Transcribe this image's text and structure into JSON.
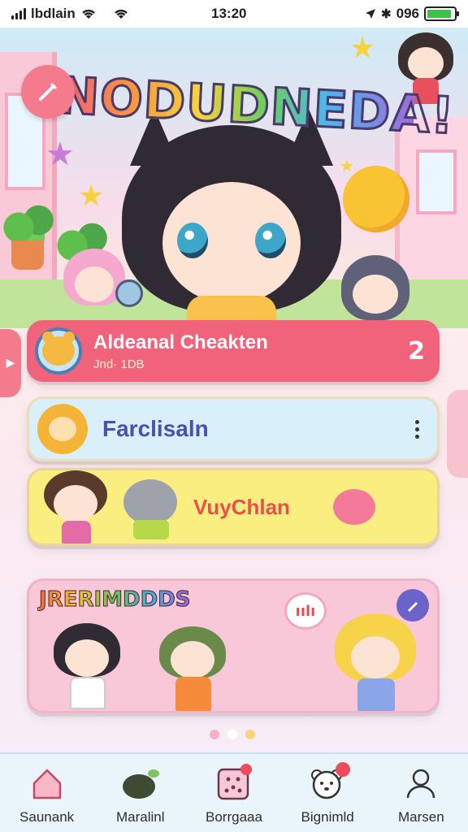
{
  "status_bar": {
    "carrier": "lbdlain",
    "time": "13:20",
    "battery_text": "096",
    "battery_level": 0.9
  },
  "hero": {
    "title": "NODUDNEDA!"
  },
  "cards": [
    {
      "title": "Aldeanal Cheakten",
      "subtitle": "Jnd· 1DB",
      "badge": "2"
    },
    {
      "title": "Farclisaln"
    },
    {
      "title": "VuyChlan"
    },
    {
      "title": "JRERIMDDDS",
      "bubble": "ıılı"
    }
  ],
  "bottom_nav": [
    {
      "label": "Saunank",
      "icon": "home-icon"
    },
    {
      "label": "Maralinl",
      "icon": "leaf-creature-icon"
    },
    {
      "label": "Borrgaaa",
      "icon": "grid-box-icon"
    },
    {
      "label": "Bignimld",
      "icon": "bear-face-icon"
    },
    {
      "label": "Marsen",
      "icon": "person-icon"
    }
  ],
  "colors": {
    "accent_pink": "#f1637a",
    "light_blue": "#d9effa",
    "yellow": "#fbee80",
    "soft_pink": "#f9c8d8",
    "nav_bg": "#eaf5fb"
  }
}
